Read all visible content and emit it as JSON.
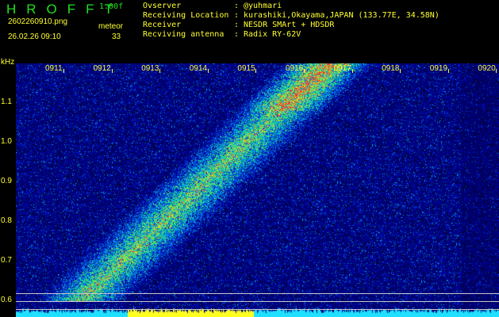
{
  "header": {
    "logo": "HROFFT",
    "version": "1.00f",
    "filename": "2602260910.png",
    "datetime": "26.02.26 09:10",
    "mode_label": "meteor",
    "count": "33"
  },
  "info": [
    {
      "label": "Ovserver",
      "value": "@yuhmari"
    },
    {
      "label": "Receiving Location",
      "value": "kurashiki,Okayama,JAPAN (133.77E, 34.58N)"
    },
    {
      "label": "Receiver",
      "value": "NESDR SMArt + HDSDR"
    },
    {
      "label": "Recviving antenna",
      "value": "Radix RY-62V"
    }
  ],
  "spectrogram": {
    "unit": "kHz",
    "y_labels": [
      "1.1",
      "1.0",
      "0.9",
      "0.8",
      "0.7",
      "0.6"
    ],
    "x_labels": [
      "0911",
      "0912",
      "0913",
      "0914",
      "0915",
      "0916",
      "0917",
      "0918",
      "0919",
      "0920"
    ]
  }
}
